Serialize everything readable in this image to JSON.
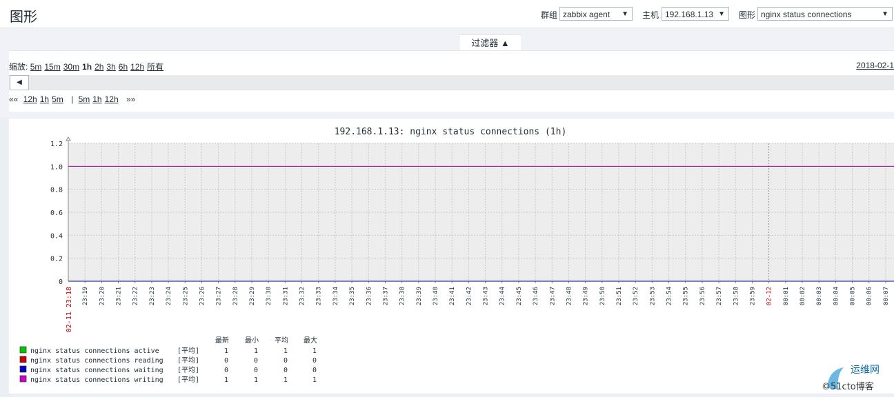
{
  "header": {
    "title": "图形",
    "group_label": "群组",
    "group_value": "zabbix agent",
    "host_label": "主机",
    "host_value": "192.168.1.13",
    "graph_label": "图形",
    "graph_value": "nginx status connections"
  },
  "filter": {
    "tab_label": "过滤器 ▲",
    "zoom_label": "缩放:",
    "zoom_options": [
      "5m",
      "15m",
      "30m",
      "1h",
      "2h",
      "3h",
      "6h",
      "12h",
      "所有"
    ],
    "zoom_active": "1h",
    "date_text": "2018-02-1",
    "nav_back": "««",
    "nav_back_items": [
      "12h",
      "1h",
      "5m"
    ],
    "nav_sep": "|",
    "nav_fwd_items": [
      "5m",
      "1h",
      "12h"
    ],
    "nav_fwd": "»»"
  },
  "chart_data": {
    "type": "line",
    "title": "192.168.1.13: nginx status connections (1h)",
    "ylim": [
      0,
      1.2
    ],
    "y_ticks": [
      "0",
      "0.2",
      "0.4",
      "0.6",
      "0.8",
      "1.0",
      "1.2"
    ],
    "x_start_label": "02-11 23:18",
    "x_ticks": [
      "23:19",
      "23:20",
      "23:21",
      "23:22",
      "23:23",
      "23:24",
      "23:25",
      "23:26",
      "23:27",
      "23:28",
      "23:29",
      "23:30",
      "23:31",
      "23:32",
      "23:33",
      "23:34",
      "23:35",
      "23:36",
      "23:37",
      "23:38",
      "23:39",
      "23:40",
      "23:41",
      "23:42",
      "23:43",
      "23:44",
      "23:45",
      "23:46",
      "23:47",
      "23:48",
      "23:49",
      "23:50",
      "23:51",
      "23:52",
      "23:53",
      "23:54",
      "23:55",
      "23:56",
      "23:57",
      "23:58",
      "23:59",
      "02-12",
      "00:01",
      "00:02",
      "00:03",
      "00:04",
      "00:05",
      "00:06",
      "00:07"
    ],
    "grid": true,
    "series": [
      {
        "name": "nginx status connections active",
        "color": "#00c800",
        "values_const": 1
      },
      {
        "name": "nginx status connections reading",
        "color": "#c80000",
        "values_const": 0
      },
      {
        "name": "nginx status connections waiting",
        "color": "#0000c8",
        "values_const": 0
      },
      {
        "name": "nginx status connections writing",
        "color": "#c800c8",
        "values_const": 1
      }
    ],
    "legend": {
      "headers": [
        "最新",
        "最小",
        "平均",
        "最大"
      ],
      "func": "[平均]",
      "rows": [
        {
          "name": "nginx status connections active",
          "color": "#00c800",
          "last": "1",
          "min": "1",
          "avg": "1",
          "max": "1"
        },
        {
          "name": "nginx status connections reading",
          "color": "#c80000",
          "last": "0",
          "min": "0",
          "avg": "0",
          "max": "0"
        },
        {
          "name": "nginx status connections waiting",
          "color": "#0000c8",
          "last": "0",
          "min": "0",
          "avg": "0",
          "max": "0"
        },
        {
          "name": "nginx status connections writing",
          "color": "#c800c8",
          "last": "1",
          "min": "1",
          "avg": "1",
          "max": "1"
        }
      ]
    }
  },
  "watermark": {
    "line1": "运维网",
    "line2": "©51cto博客"
  }
}
